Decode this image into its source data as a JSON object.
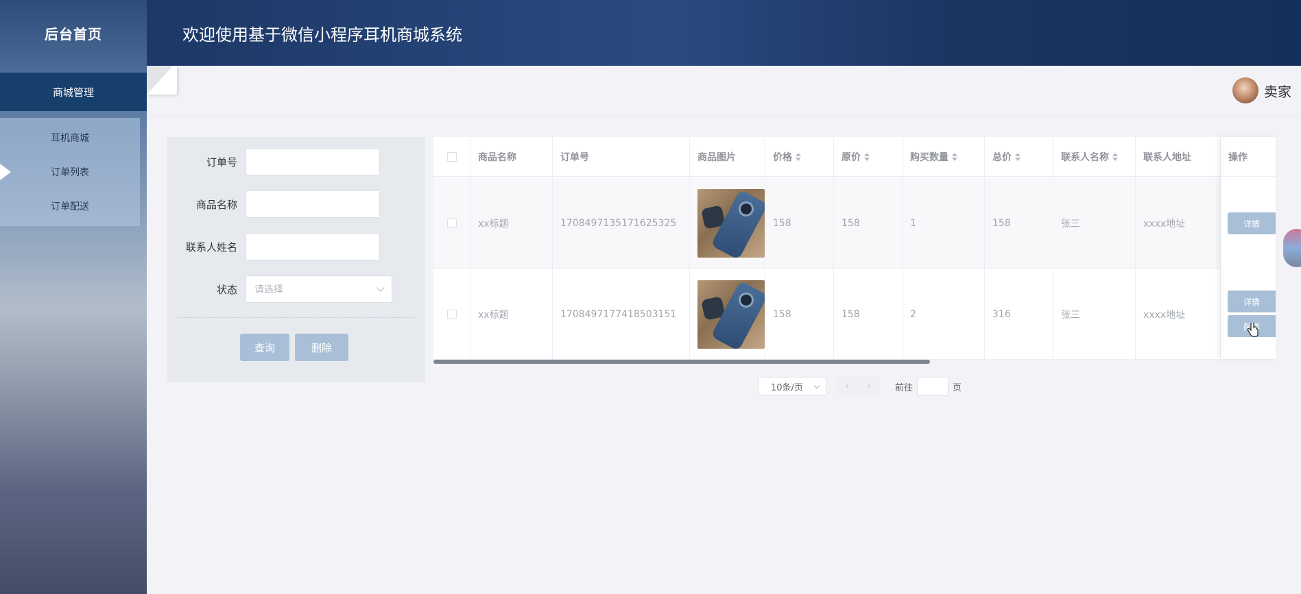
{
  "sidebar": {
    "logo": "后台首页",
    "group": "商城管理",
    "items": [
      {
        "label": "耳机商城",
        "active": false
      },
      {
        "label": "订单列表",
        "active": true
      },
      {
        "label": "订单配送",
        "active": false
      }
    ]
  },
  "header": {
    "title": "欢迎使用基于微信小程序耳机商城系统"
  },
  "user": {
    "name": "卖家"
  },
  "search": {
    "order_no_label": "订单号",
    "order_no_value": "",
    "product_name_label": "商品名称",
    "product_name_value": "",
    "contact_name_label": "联系人姓名",
    "contact_name_value": "",
    "status_label": "状态",
    "status_placeholder": "请选择",
    "query_button": "查询",
    "delete_button": "删除"
  },
  "table": {
    "columns": {
      "product_name": "商品名称",
      "order_no": "订单号",
      "product_image": "商品图片",
      "price": "价格",
      "original_price": "原价",
      "quantity": "购买数量",
      "total": "总价",
      "contact_name": "联系人名称",
      "contact_address": "联系人地址",
      "actions": "操作"
    },
    "rows": [
      {
        "product_name": "xx标题",
        "order_no": "1708497135171625325",
        "price": "158",
        "original_price": "158",
        "quantity": "1",
        "total": "158",
        "contact_name": "张三",
        "contact_address": "xxxx地址",
        "detail_button": "详情"
      },
      {
        "product_name": "xx标题",
        "order_no": "1708497177418503151",
        "price": "158",
        "original_price": "158",
        "quantity": "2",
        "total": "316",
        "contact_name": "张三",
        "contact_address": "xxxx地址",
        "detail_button": "详情",
        "ship_button": "配送"
      }
    ]
  },
  "pagination": {
    "page_size": "10条/页",
    "prev_icon": "‹",
    "next_icon": "›",
    "goto_label": "前往",
    "page_unit": "页",
    "goto_value": ""
  },
  "colors": {
    "header_bg": "#1d3866",
    "menu_active_bg": "#173f6c",
    "button_bg": "#a9bfd8"
  }
}
